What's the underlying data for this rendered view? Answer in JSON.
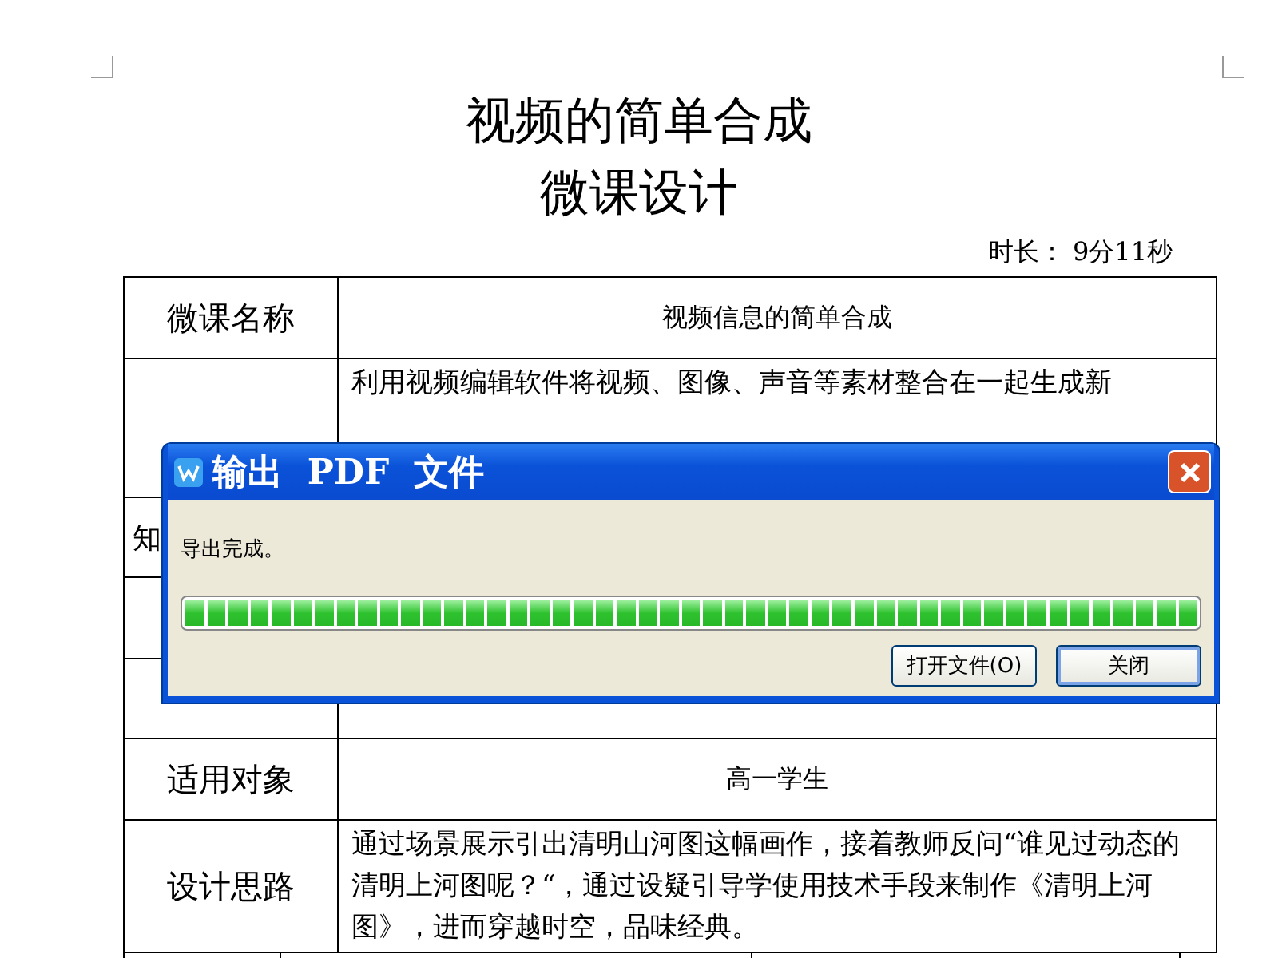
{
  "document": {
    "title": "视频的简单合成",
    "subtitle": "微课设计",
    "duration": "时长：  9分11秒"
  },
  "table": {
    "rows": [
      {
        "label": "微课名称",
        "value": "视频信息的简单合成",
        "kind": "center"
      },
      {
        "label": "",
        "value": "利用视频编辑软件将视频、图像、声音等素材整合在一起生成新",
        "kind": "text"
      },
      {
        "label": "知",
        "value": "",
        "kind": "partial"
      },
      {
        "label": "",
        "value": "",
        "kind": "center"
      },
      {
        "label": "",
        "value": "",
        "kind": "center"
      },
      {
        "label": "适用对象",
        "value": "高一学生",
        "kind": "center"
      },
      {
        "label": "设计思路",
        "value": "通过场景展示引出清明山河图这幅画作，接着教师反问“谁见过动态的清明上河图呢？“，通过设疑引导学使用技术手段来制作《清明上河图》，进而穿越时空，品味经典。",
        "kind": "text"
      }
    ]
  },
  "dialog": {
    "title": "输出  PDF  文件",
    "message": "导出完成。",
    "level": 1,
    "buttons": [
      {
        "label": "打开文件(O)",
        "default": false
      },
      {
        "label": "关闭",
        "default": true
      }
    ]
  }
}
